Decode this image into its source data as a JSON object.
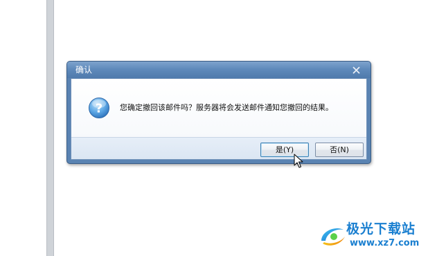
{
  "dialog": {
    "title": "确认",
    "message": "您确定撤回该邮件吗？服务器将会发送邮件通知您撤回的结果。",
    "buttons": {
      "yes_label": "是(Y)",
      "no_label": "否(N)"
    },
    "icon": "question-icon"
  },
  "watermark": {
    "title": "极光下载站",
    "url": "www.xz7.com"
  },
  "colors": {
    "titlebar": "#5f8abb",
    "dialog_border": "#3a5d86",
    "button_bar": "#e0e9f5",
    "watermark": "#1a7fd0"
  }
}
